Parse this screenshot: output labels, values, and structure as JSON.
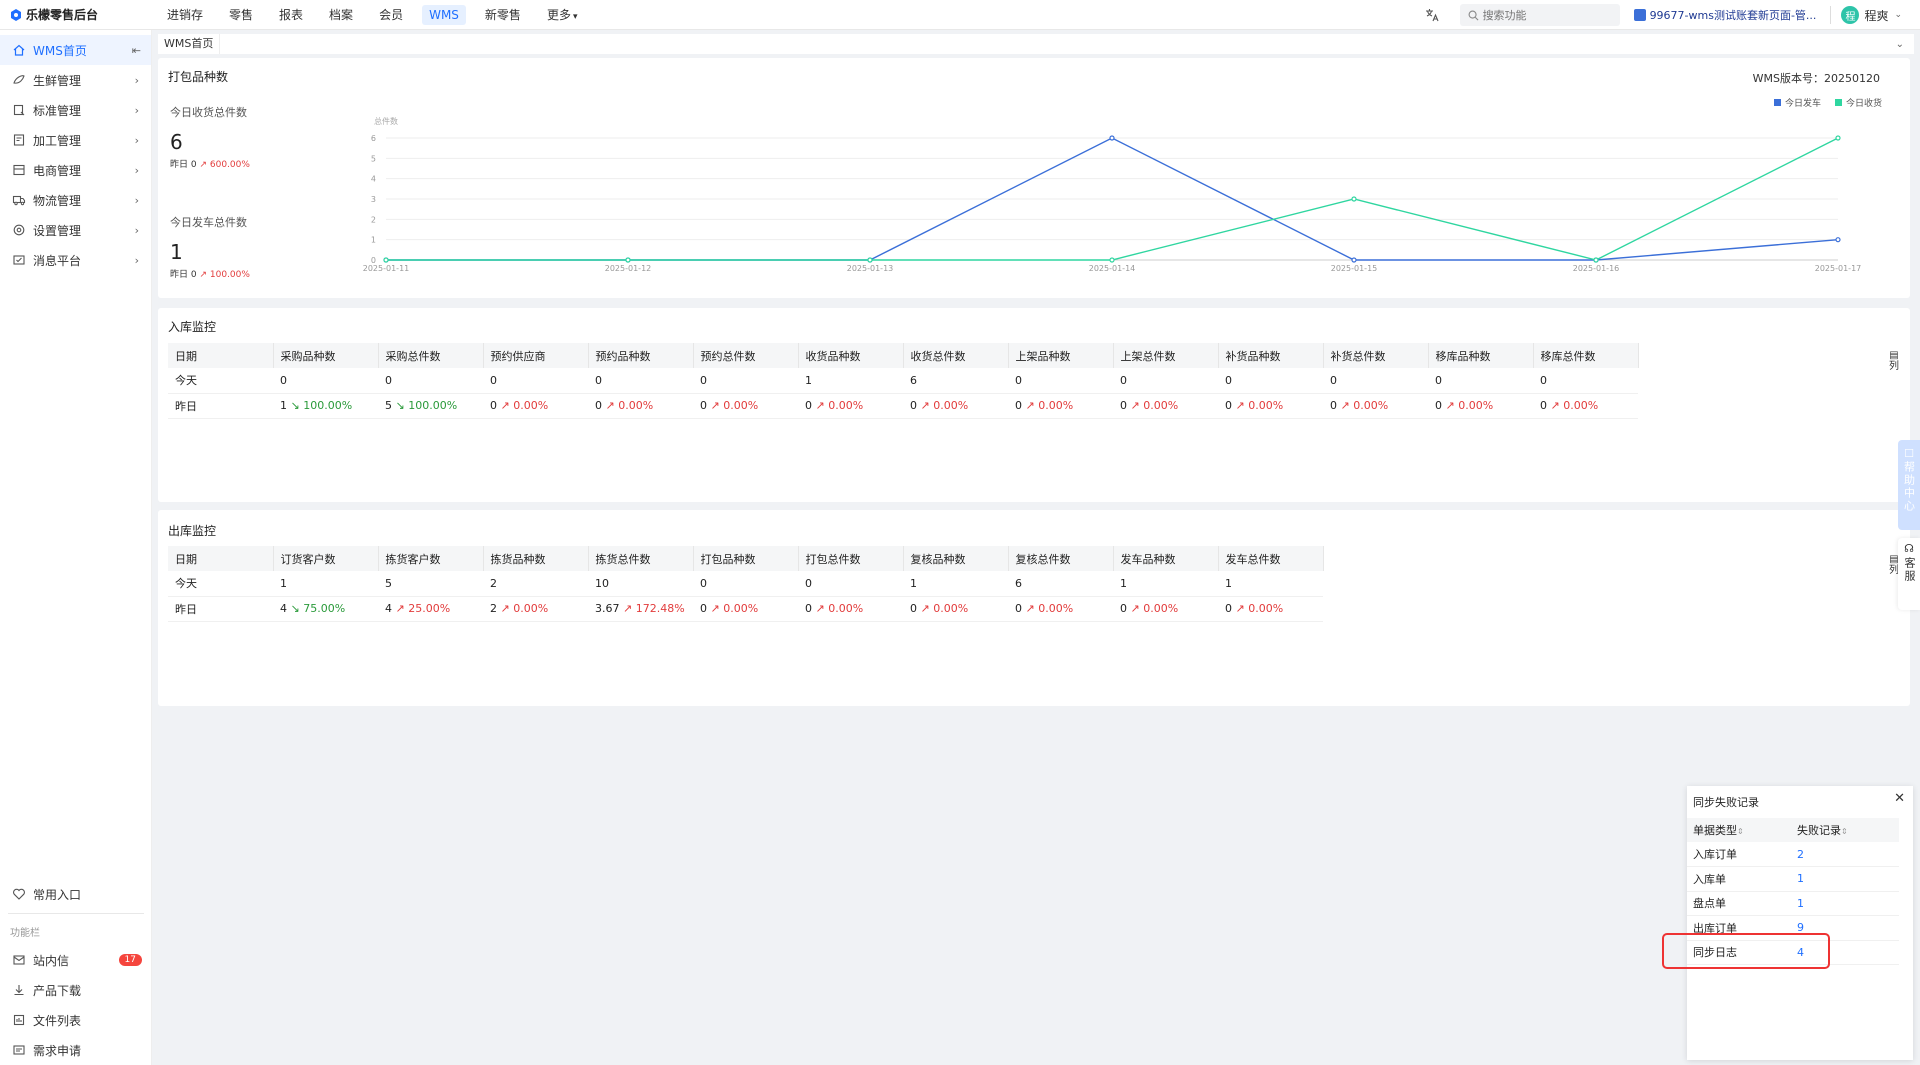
{
  "app": {
    "name": "乐檬零售后台"
  },
  "topnav": {
    "items": [
      "进销存",
      "零售",
      "报表",
      "档案",
      "会员",
      "WMS",
      "新零售"
    ],
    "more": "更多",
    "active": "WMS"
  },
  "search": {
    "placeholder": "搜索功能"
  },
  "account": {
    "label": "99677-wms测试账套新页面-管..."
  },
  "user": {
    "name": "程爽",
    "avatar": "程"
  },
  "sidebar": {
    "items": [
      {
        "label": "WMS首页",
        "icon": "home-icon"
      },
      {
        "label": "生鲜管理",
        "icon": "fresh-icon"
      },
      {
        "label": "标准管理",
        "icon": "standard-icon"
      },
      {
        "label": "加工管理",
        "icon": "process-icon"
      },
      {
        "label": "电商管理",
        "icon": "ecommerce-icon"
      },
      {
        "label": "物流管理",
        "icon": "truck-icon"
      },
      {
        "label": "设置管理",
        "icon": "gear-icon"
      },
      {
        "label": "消息平台",
        "icon": "message-icon"
      }
    ],
    "favorites": "常用入口",
    "caption": "功能栏",
    "bottom": [
      {
        "label": "站内信",
        "icon": "mail-icon",
        "badge": "17"
      },
      {
        "label": "产品下载",
        "icon": "download-icon"
      },
      {
        "label": "文件列表",
        "icon": "file-list-icon"
      },
      {
        "label": "需求申请",
        "icon": "request-icon"
      }
    ]
  },
  "tab": {
    "label": "WMS首页"
  },
  "pack": {
    "title": "打包品种数",
    "version": "WMS版本号：20250120",
    "receive_label": "今日收货总件数",
    "receive_value": "6",
    "receive_yest": "昨日  0",
    "receive_pct": "600.00%",
    "ship_label": "今日发车总件数",
    "ship_value": "1",
    "ship_yest": "昨日  0",
    "ship_pct": "100.00%"
  },
  "chart_data": {
    "type": "line",
    "ylabel": "总件数",
    "x": [
      "2025-01-11",
      "2025-01-12",
      "2025-01-13",
      "2025-01-14",
      "2025-01-15",
      "2025-01-16",
      "2025-01-17"
    ],
    "ylim": [
      0,
      6
    ],
    "yticks": [
      0,
      1,
      2,
      3,
      4,
      5,
      6
    ],
    "legend_position": "top-right",
    "series": [
      {
        "name": "今日发车",
        "color": "#3b6fd8",
        "values": [
          0,
          0,
          0,
          6,
          0,
          0,
          1
        ]
      },
      {
        "name": "今日收货",
        "color": "#2fd6a0",
        "values": [
          0,
          0,
          0,
          0,
          3,
          0,
          6
        ]
      }
    ]
  },
  "inbound": {
    "title": "入库监控",
    "columns": [
      "日期",
      "采购品种数",
      "采购总件数",
      "预约供应商",
      "预约品种数",
      "预约总件数",
      "收货品种数",
      "收货总件数",
      "上架品种数",
      "上架总件数",
      "补货品种数",
      "补货总件数",
      "移库品种数",
      "移库总件数"
    ],
    "today": [
      "今天",
      "0",
      "0",
      "0",
      "0",
      "0",
      "1",
      "6",
      "0",
      "0",
      "0",
      "0",
      "0",
      "0"
    ],
    "yesterday": [
      {
        "v": "昨日",
        "t": ""
      },
      {
        "v": "1",
        "t": "100.00%",
        "d": "down"
      },
      {
        "v": "5",
        "t": "100.00%",
        "d": "down"
      },
      {
        "v": "0",
        "t": "0.00%",
        "d": "up"
      },
      {
        "v": "0",
        "t": "0.00%",
        "d": "up"
      },
      {
        "v": "0",
        "t": "0.00%",
        "d": "up"
      },
      {
        "v": "0",
        "t": "0.00%",
        "d": "up"
      },
      {
        "v": "0",
        "t": "0.00%",
        "d": "up"
      },
      {
        "v": "0",
        "t": "0.00%",
        "d": "up"
      },
      {
        "v": "0",
        "t": "0.00%",
        "d": "up"
      },
      {
        "v": "0",
        "t": "0.00%",
        "d": "up"
      },
      {
        "v": "0",
        "t": "0.00%",
        "d": "up"
      },
      {
        "v": "0",
        "t": "0.00%",
        "d": "up"
      },
      {
        "v": "0",
        "t": "0.00%",
        "d": "up"
      }
    ],
    "column_toggle": "列"
  },
  "outbound": {
    "title": "出库监控",
    "columns": [
      "日期",
      "订货客户数",
      "拣货客户数",
      "拣货品种数",
      "拣货总件数",
      "打包品种数",
      "打包总件数",
      "复核品种数",
      "复核总件数",
      "发车品种数",
      "发车总件数"
    ],
    "today": [
      "今天",
      "1",
      "5",
      "2",
      "10",
      "0",
      "0",
      "1",
      "6",
      "1",
      "1"
    ],
    "yesterday": [
      {
        "v": "昨日",
        "t": ""
      },
      {
        "v": "4",
        "t": "75.00%",
        "d": "down"
      },
      {
        "v": "4",
        "t": "25.00%",
        "d": "up"
      },
      {
        "v": "2",
        "t": "0.00%",
        "d": "up"
      },
      {
        "v": "3.67",
        "t": "172.48%",
        "d": "up"
      },
      {
        "v": "0",
        "t": "0.00%",
        "d": "up"
      },
      {
        "v": "0",
        "t": "0.00%",
        "d": "up"
      },
      {
        "v": "0",
        "t": "0.00%",
        "d": "up"
      },
      {
        "v": "0",
        "t": "0.00%",
        "d": "up"
      },
      {
        "v": "0",
        "t": "0.00%",
        "d": "up"
      },
      {
        "v": "0",
        "t": "0.00%",
        "d": "up"
      }
    ],
    "column_toggle": "列"
  },
  "help": {
    "label": "帮助中心",
    "service": "客服"
  },
  "sync": {
    "title": "同步失败记录",
    "columns": [
      "单据类型",
      "失败记录"
    ],
    "rows": [
      [
        "入库订单",
        "2"
      ],
      [
        "入库单",
        "1"
      ],
      [
        "盘点单",
        "1"
      ],
      [
        "出库订单",
        "9"
      ],
      [
        "同步日志",
        "4"
      ]
    ]
  }
}
